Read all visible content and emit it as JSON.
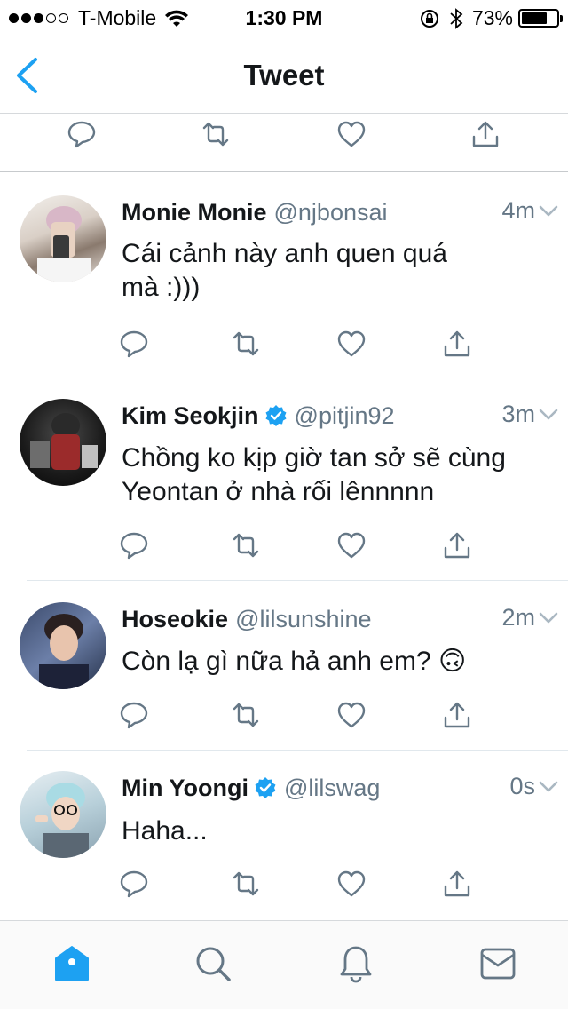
{
  "status": {
    "carrier": "T-Mobile",
    "time": "1:30 PM",
    "battery": "73%",
    "battery_level": 0.73,
    "signal_bars": 3,
    "signal_total": 5
  },
  "nav": {
    "title": "Tweet"
  },
  "colors": {
    "accent": "#1da1f2",
    "icon": "#657786",
    "text": "#14171a",
    "secondary": "#657786"
  },
  "tweets": [
    {
      "name": "Monie Monie",
      "handle": "@njbonsai",
      "verified": false,
      "time": "4m",
      "text_lines": [
        "Cái cảnh này anh quen quá",
        "mà :)))"
      ]
    },
    {
      "name": "Kim Seokjin",
      "handle": "@pitjin92",
      "verified": true,
      "time": "3m",
      "text_lines": [
        "Chồng ko kịp giờ tan sở sẽ cùng",
        "Yeontan ở nhà rối lênnnnn"
      ]
    },
    {
      "name": "Hoseokie",
      "handle": "@lilsunshine",
      "verified": false,
      "time": "2m",
      "text_lines": [
        "Còn lạ gì nữa hả anh em? 🙃"
      ]
    },
    {
      "name": "Min Yoongi",
      "handle": "@lilswag",
      "verified": true,
      "time": "0s",
      "text_lines": [
        "Haha..."
      ]
    }
  ],
  "tabs": [
    "home-icon",
    "search-icon",
    "notifications-icon",
    "messages-icon"
  ]
}
